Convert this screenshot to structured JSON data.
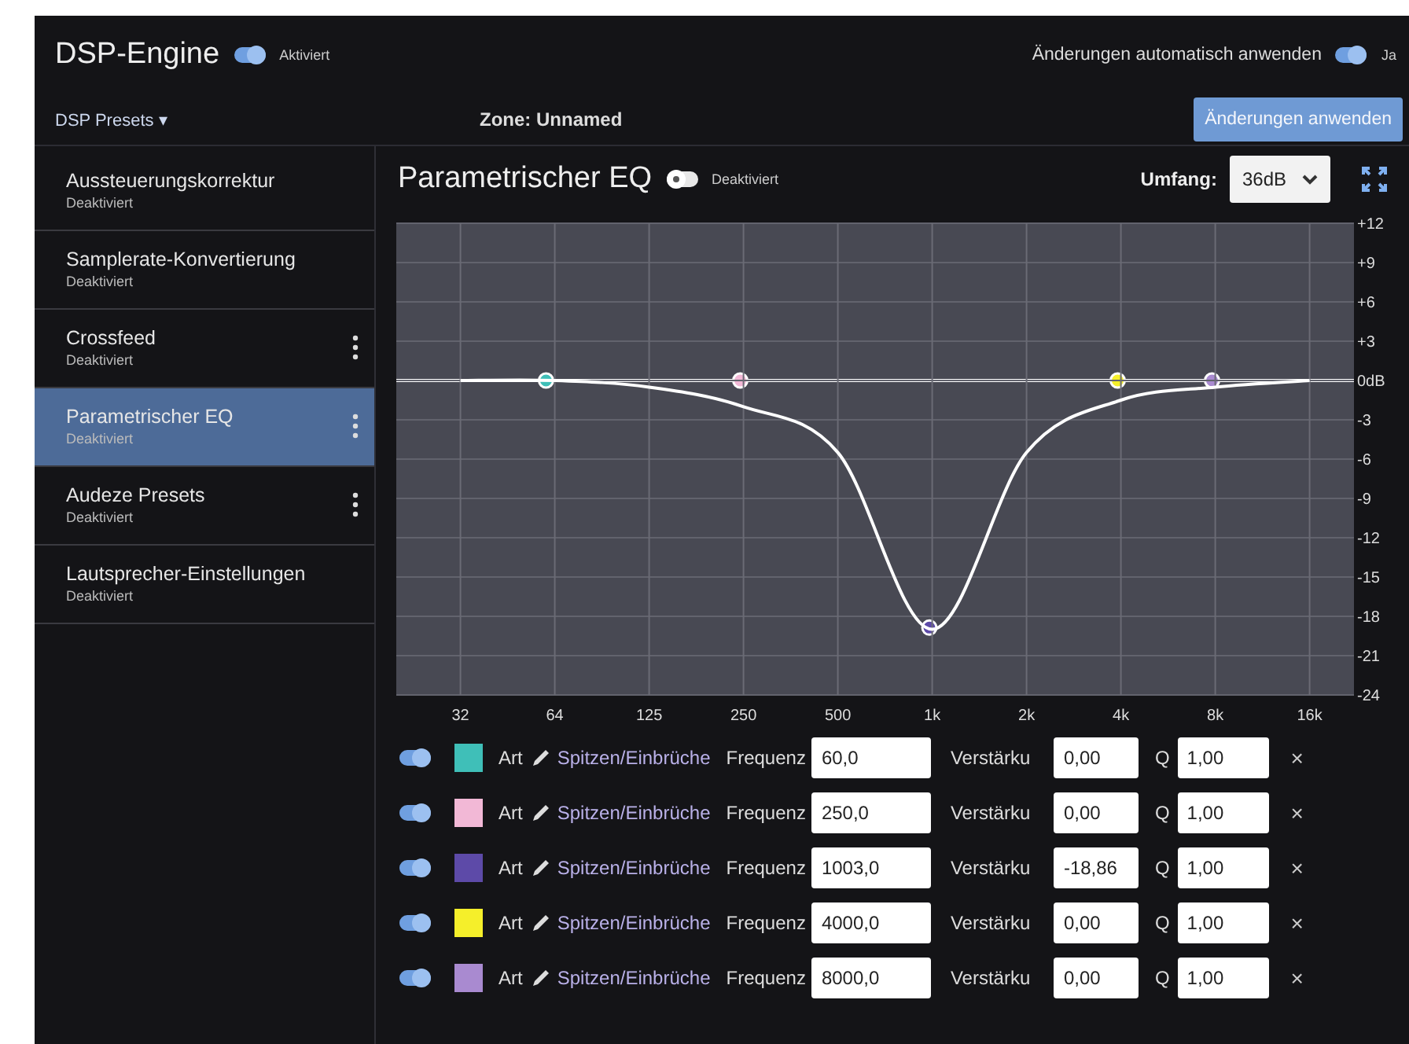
{
  "header": {
    "title": "DSP-Engine",
    "engine_toggle": {
      "on": true,
      "label": "Aktiviert"
    },
    "auto_apply": {
      "label": "Änderungen automatisch anwenden",
      "on": true,
      "state_label": "Ja"
    },
    "presets_menu": "DSP Presets ▾",
    "zone": "Zone: Unnamed",
    "apply_button": "Änderungen anwenden"
  },
  "sidebar": {
    "items": [
      {
        "name": "Aussteuerungskorrektur",
        "status": "Deaktiviert",
        "selected": false,
        "has_menu": false
      },
      {
        "name": "Samplerate-Konvertierung",
        "status": "Deaktiviert",
        "selected": false,
        "has_menu": false
      },
      {
        "name": "Crossfeed",
        "status": "Deaktiviert",
        "selected": false,
        "has_menu": true
      },
      {
        "name": "Parametrischer EQ",
        "status": "Deaktiviert",
        "selected": true,
        "has_menu": true
      },
      {
        "name": "Audeze Presets",
        "status": "Deaktiviert",
        "selected": false,
        "has_menu": true
      },
      {
        "name": "Lautsprecher-Einstellungen",
        "status": "Deaktiviert",
        "selected": false,
        "has_menu": false
      }
    ]
  },
  "eq": {
    "title": "Parametrischer EQ",
    "toggle": {
      "on": false,
      "label": "Deaktiviert"
    },
    "range_label": "Umfang:",
    "range": "36dB",
    "chart_data": {
      "type": "line",
      "grid": true,
      "categories": [
        "32",
        "64",
        "125",
        "250",
        "500",
        "1k",
        "2k",
        "4k",
        "8k",
        "16k"
      ],
      "ylim": [
        -24,
        12
      ],
      "yticks": [
        {
          "value": 12,
          "label": "+12"
        },
        {
          "value": 9,
          "label": "+9"
        },
        {
          "value": 6,
          "label": "+6"
        },
        {
          "value": 3,
          "label": "+3"
        },
        {
          "value": 0,
          "label": "0dB"
        },
        {
          "value": -3,
          "label": "-3"
        },
        {
          "value": -6,
          "label": "-6"
        },
        {
          "value": -9,
          "label": "-9"
        },
        {
          "value": -12,
          "label": "-12"
        },
        {
          "value": -15,
          "label": "-15"
        },
        {
          "value": -18,
          "label": "-18"
        },
        {
          "value": -21,
          "label": "-21"
        },
        {
          "value": -24,
          "label": "-24"
        }
      ],
      "series": [
        {
          "color": "#ffffff",
          "values": [
            0,
            0,
            -0.5,
            -2,
            -5.5,
            -19,
            -5.5,
            -1.5,
            -0.5,
            0
          ]
        }
      ]
    },
    "bands": [
      {
        "enabled": true,
        "color": "#3fbfb8",
        "type_label": "Art",
        "type": "Spitzen/Einbrüche",
        "freq_label": "Frequenz",
        "freq": "60,0",
        "gain_label": "Verstärku",
        "gain": "0,00",
        "q_label": "Q",
        "q": "1,00",
        "remove": "×"
      },
      {
        "enabled": true,
        "color": "#f2b8d6",
        "type_label": "Art",
        "type": "Spitzen/Einbrüche",
        "freq_label": "Frequenz",
        "freq": "250,0",
        "gain_label": "Verstärku",
        "gain": "0,00",
        "q_label": "Q",
        "q": "1,00",
        "remove": "×"
      },
      {
        "enabled": true,
        "color": "#5d4aa8",
        "type_label": "Art",
        "type": "Spitzen/Einbrüche",
        "freq_label": "Frequenz",
        "freq": "1003,0",
        "gain_label": "Verstärku",
        "gain": "-18,86",
        "q_label": "Q",
        "q": "1,00",
        "remove": "×"
      },
      {
        "enabled": true,
        "color": "#f5ef2a",
        "type_label": "Art",
        "type": "Spitzen/Einbrüche",
        "freq_label": "Frequenz",
        "freq": "4000,0",
        "gain_label": "Verstärku",
        "gain": "0,00",
        "q_label": "Q",
        "q": "1,00",
        "remove": "×"
      },
      {
        "enabled": true,
        "color": "#a98ad0",
        "type_label": "Art",
        "type": "Spitzen/Einbrüche",
        "freq_label": "Frequenz",
        "freq": "8000,0",
        "gain_label": "Verstärku",
        "gain": "0,00",
        "q_label": "Q",
        "q": "1,00",
        "remove": "×"
      }
    ]
  }
}
